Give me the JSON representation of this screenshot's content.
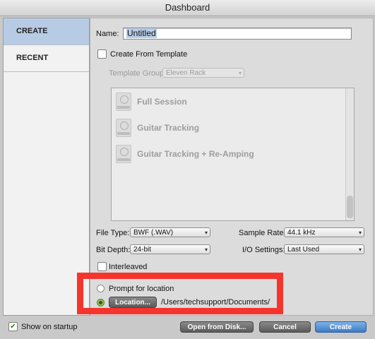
{
  "window": {
    "title": "Dashboard"
  },
  "sidebar": {
    "items": [
      {
        "label": "CREATE"
      },
      {
        "label": "RECENT"
      }
    ]
  },
  "create": {
    "name_label": "Name:",
    "name_value": "Untitled",
    "create_from_template_label": "Create From Template",
    "template_group_label": "Template Group:",
    "template_group_value": "Eleven Rack",
    "templates": [
      {
        "name": "Full Session",
        "icon": "template-icon"
      },
      {
        "name": "Guitar Tracking",
        "icon": "template-icon"
      },
      {
        "name": "Guitar Tracking + Re-Amping",
        "icon": "template-icon"
      }
    ],
    "file_type_label": "File Type:",
    "file_type_value": "BWF (.WAV)",
    "sample_rate_label": "Sample Rate:",
    "sample_rate_value": "44.1 kHz",
    "bit_depth_label": "Bit Depth:",
    "bit_depth_value": "24-bit",
    "io_settings_label": "I/O Settings:",
    "io_settings_value": "Last Used",
    "interleaved_label": "Interleaved",
    "prompt_location_label": "Prompt for location",
    "location_button_label": "Location...",
    "location_path": "/Users/techsupport/Documents/"
  },
  "footer": {
    "show_on_startup_label": "Show on startup",
    "open_from_disk_label": "Open from Disk...",
    "cancel_label": "Cancel",
    "create_label": "Create"
  },
  "colors": {
    "highlight": "#f5352d",
    "sidebar_active": "#b8cbe5",
    "primary_button": "#3d7cc4"
  }
}
